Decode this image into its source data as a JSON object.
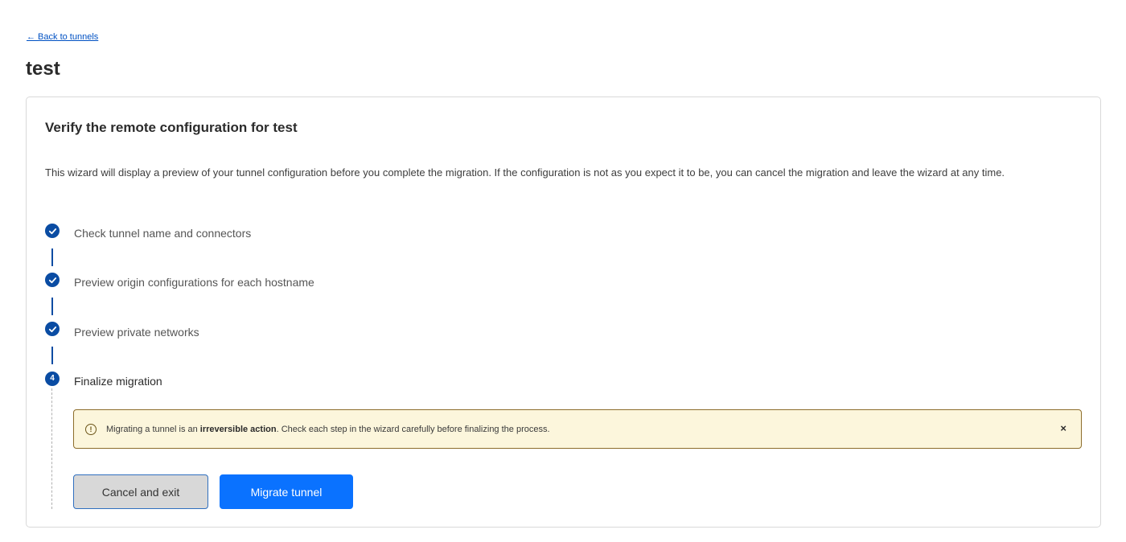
{
  "nav": {
    "back_label": "← Back to tunnels"
  },
  "page": {
    "title": "test"
  },
  "wizard": {
    "title": "Verify the remote configuration for test",
    "description": "This wizard will display a preview of your tunnel configuration before you complete the migration. If the configuration is not as you expect it to be, you can cancel the migration and leave the wizard at any time.",
    "steps": [
      {
        "label": "Check tunnel name and connectors",
        "status": "complete"
      },
      {
        "label": "Preview origin configurations for each hostname",
        "status": "complete"
      },
      {
        "label": "Preview private networks",
        "status": "complete"
      },
      {
        "label": "Finalize migration",
        "status": "current",
        "number": "4"
      }
    ],
    "alert": {
      "text_before": "Migrating a tunnel is an ",
      "text_bold": "irreversible action",
      "text_after": ". Check each step in the wizard carefully before finalizing the process.",
      "icon": "!",
      "close": "×"
    },
    "buttons": {
      "cancel": "Cancel and exit",
      "migrate": "Migrate tunnel"
    }
  },
  "colors": {
    "accent": "#0a4ca3",
    "primary_button": "#0a72ff",
    "link": "#0051c3",
    "alert_bg": "#fcf6dc",
    "alert_border": "#8d6d2b"
  }
}
